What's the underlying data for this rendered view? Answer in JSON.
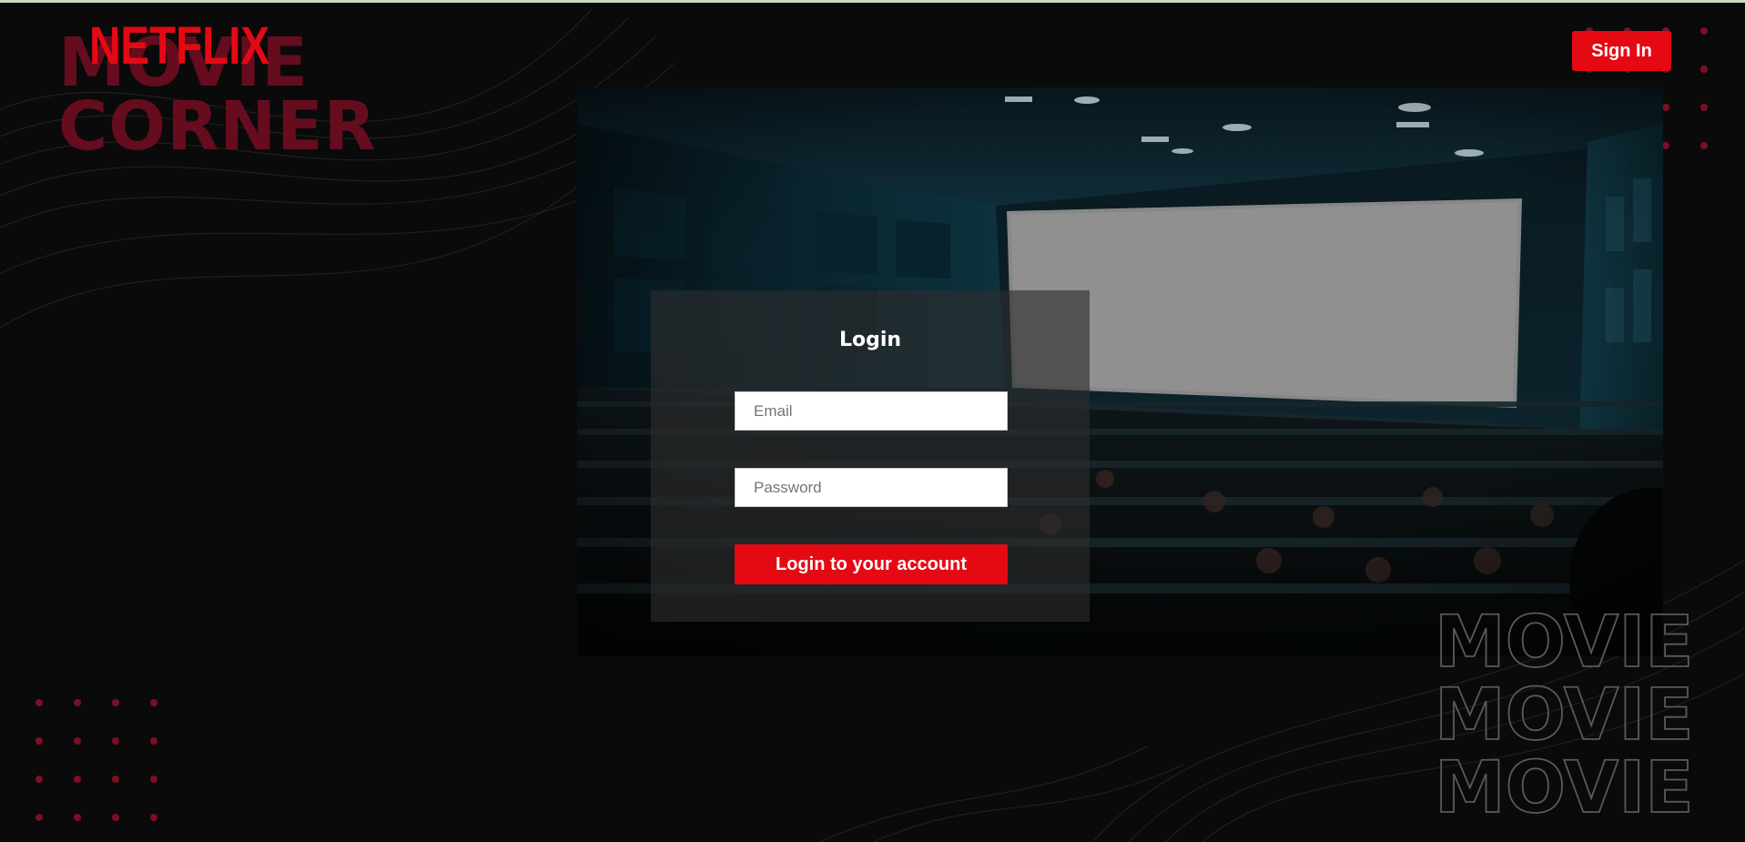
{
  "top_bar": {
    "logo": "NETFLIX",
    "sign_in_label": "Sign In"
  },
  "background": {
    "brand_lines": [
      "MOVIE",
      "CORNER"
    ],
    "outline_words": [
      "MOVIE",
      "MOVIE",
      "MOVIE"
    ]
  },
  "login": {
    "title": "Login",
    "email_placeholder": "Email",
    "password_placeholder": "Password",
    "submit_label": "Login to your account"
  },
  "colors": {
    "accent": "#e50914",
    "brand_back": "#6b0d21",
    "dots": "#7c0f24",
    "background": "#0a0a0a"
  },
  "icons": {
    "dot_grid": "decorative-dot-grid",
    "hero_image": "cinema-theater-image"
  }
}
